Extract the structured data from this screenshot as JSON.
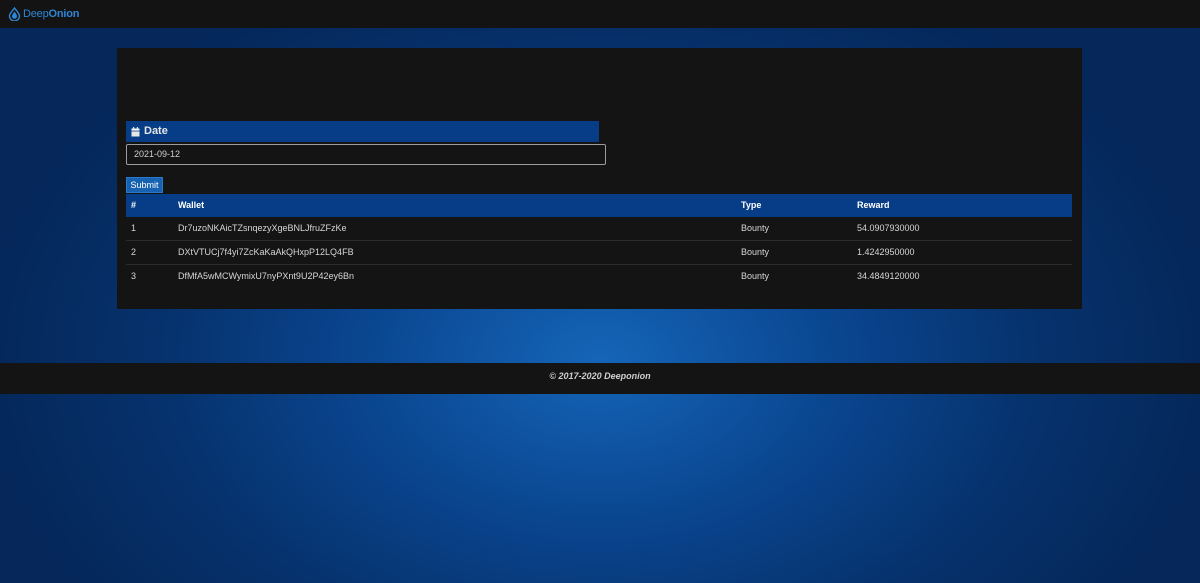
{
  "brand": {
    "part1": "Deep",
    "part2": "Onion",
    "icon": "onion-drop-icon",
    "accent": "#2e86d6"
  },
  "form": {
    "date_label": "Date",
    "date_icon": "calendar-icon",
    "date_value": "2021-09-12",
    "submit_label": "Submit"
  },
  "table": {
    "columns": [
      "#",
      "Wallet",
      "Type",
      "Reward"
    ],
    "rows": [
      [
        "1",
        "Dr7uzoNKAicTZsnqezyXgeBNLJfruZFzKe",
        "Bounty",
        "54.0907930000"
      ],
      [
        "2",
        "DXtVTUCj7f4yi7ZcKaKaAkQHxpP12LQ4FB",
        "Bounty",
        "1.4242950000"
      ],
      [
        "3",
        "DfMfA5wMCWymixU7nyPXnt9U2P42ey6Bn",
        "Bounty",
        "34.4849120000"
      ]
    ]
  },
  "colors": {
    "header_blue": "#063d86",
    "button_blue": "#1762b0",
    "panel": "#141414"
  },
  "footer": {
    "text": "© 2017-2020 Deeponion"
  }
}
